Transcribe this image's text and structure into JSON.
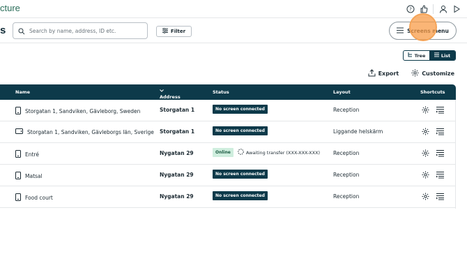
{
  "header": {
    "brand_fragment": "cture",
    "icons": [
      "help-icon",
      "thumbs-up-icon",
      "user-icon",
      "play-icon"
    ]
  },
  "toolbar": {
    "page_title_fragment": "s",
    "search_placeholder": "Search by name, address, ID etc.",
    "filter_label": "Filter",
    "screens_menu_label": "Screens menu"
  },
  "view_toggle": {
    "tree_label": "Tree",
    "list_label": "List",
    "active": "List"
  },
  "actions": {
    "export_label": "Export",
    "customize_label": "Customize"
  },
  "table": {
    "headers": {
      "name": "Name",
      "address": "Address",
      "status": "Status",
      "layout": "Layout",
      "shortcuts": "Shortcuts"
    },
    "rows": [
      {
        "name": "Storgatan 1, Sandviken, Gävleborg, Sweden",
        "device_icon": "portrait-screen-icon",
        "address": "Storgatan 1",
        "status": "No screen connected",
        "status_kind": "none",
        "awaiting": "",
        "layout": "Reception"
      },
      {
        "name": "Storgatan 1, Sandviken, Gävleborgs län, Sverige",
        "device_icon": "landscape-screen-icon",
        "address": "Storgatan 1",
        "status": "No screen connected",
        "status_kind": "none",
        "awaiting": "",
        "layout": "Liggande helskärm"
      },
      {
        "name": "Entré",
        "device_icon": "portrait-screen-icon",
        "address": "Nygatan 29",
        "status": "Online",
        "status_kind": "online",
        "awaiting": "Awaiting transfer (XXX-XXX-XXX)",
        "layout": "Reception"
      },
      {
        "name": "Matsal",
        "device_icon": "portrait-screen-icon",
        "address": "Nygatan 29",
        "status": "No screen connected",
        "status_kind": "none",
        "awaiting": "",
        "layout": "Reception"
      },
      {
        "name": "Food court",
        "device_icon": "portrait-screen-icon",
        "address": "Nygatan 29",
        "status": "No screen connected",
        "status_kind": "none",
        "awaiting": "",
        "layout": "Reception"
      }
    ]
  },
  "colors": {
    "header_bg": "#0d3a4a",
    "brand_green": "#2b6e5a",
    "online_bg": "#cfeede",
    "cursor_highlight": "#f89c48"
  }
}
